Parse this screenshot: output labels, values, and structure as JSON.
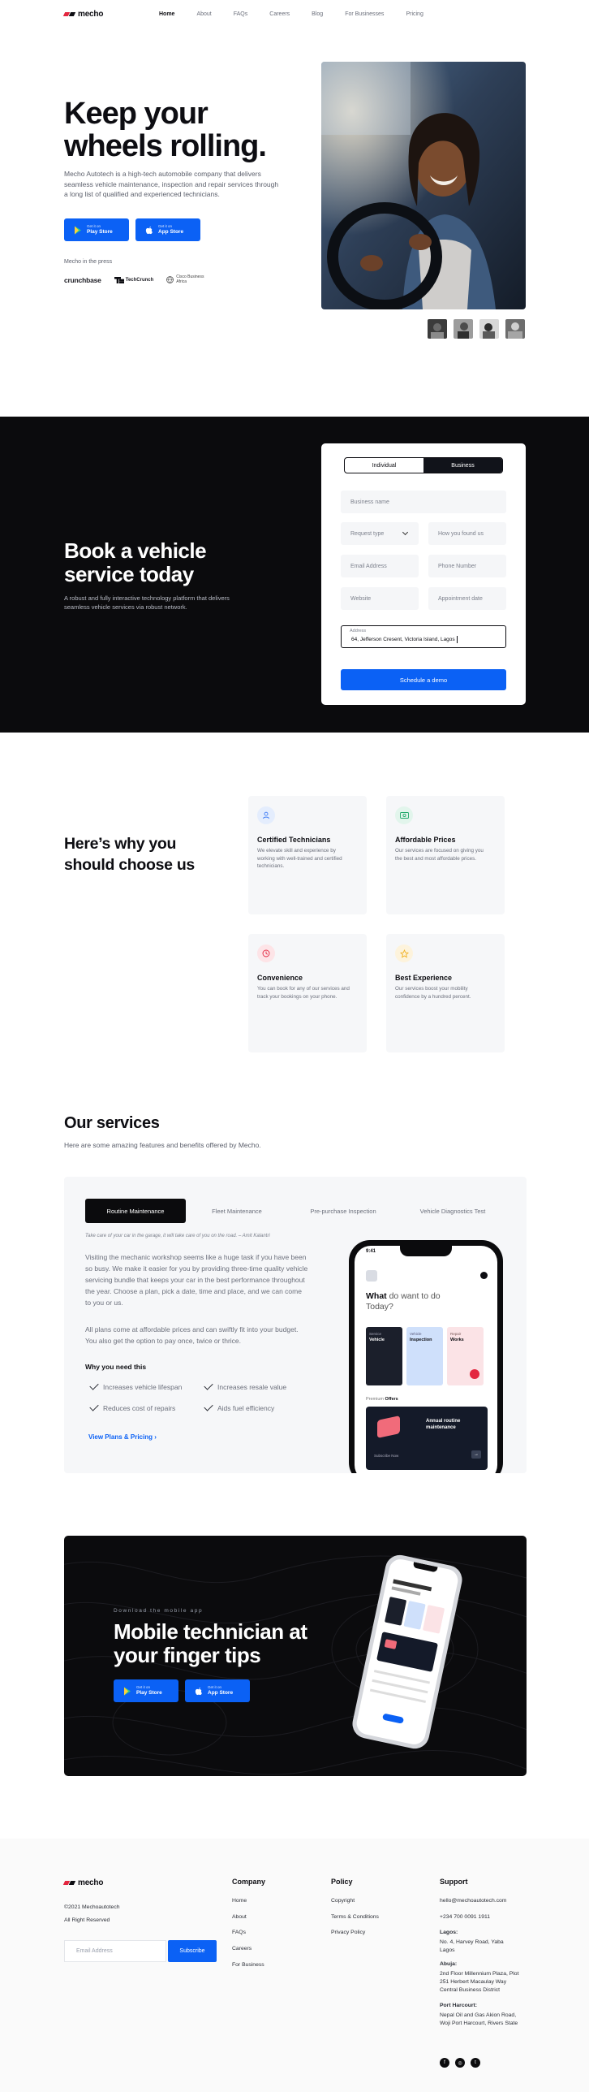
{
  "brand": {
    "name": "mecho",
    "colors": {
      "primary": "#0b61f5",
      "dark": "#0b0b0d",
      "logo_red": "#e3263f"
    }
  },
  "nav": {
    "items": [
      "Home",
      "About",
      "FAQs",
      "Careers",
      "Blog",
      "For Businesses",
      "Pricing"
    ],
    "active": "Home"
  },
  "hero": {
    "title": "Keep your wheels rolling.",
    "subtitle": "Mecho Autotech is a high-tech automobile company that delivers seamless vehicle maintenance, inspection and repair services through a long list of qualified and experienced technicians.",
    "play_store": {
      "small": "Get it on",
      "label": "Play Store"
    },
    "app_store": {
      "small": "Get it on",
      "label": "App Store"
    },
    "press_label": "Mecho in the press",
    "press_logos": [
      "crunchbase",
      "TechCrunch",
      "Cisco Business Africa"
    ]
  },
  "book": {
    "title": "Book a vehicle service today",
    "subtitle": "A robust and fully interactive technology platform that delivers seamless vehicle services via robust network.",
    "tabs": [
      "Individual",
      "Business"
    ],
    "active_tab": "Business",
    "fields": {
      "business_name": "Business name",
      "request_type": "Request type",
      "how_found": "How you found us",
      "email": "Email Address",
      "phone": "Phone Number",
      "website": "Website",
      "appointment": "Appointment date",
      "address_label": "Address",
      "address_value": "64, Jefferson Cresent, Victoria Island, Lagos"
    },
    "submit": "Schedule a demo"
  },
  "why": {
    "title": "Here’s why you should choose us",
    "features": [
      {
        "title": "Certified Technicians",
        "desc": "We elevate skill and experience by working with well-trained and certified technicians.",
        "icon": "user-icon",
        "color": "#3d7bf5"
      },
      {
        "title": "Affordable Prices",
        "desc": "Our services are focused on giving you the best and most affordable prices.",
        "icon": "money-icon",
        "color": "#22a86b"
      },
      {
        "title": "Convenience",
        "desc": "You can book for any of our services and track your bookings on your phone.",
        "icon": "clock-icon",
        "color": "#e3263f"
      },
      {
        "title": "Best Experience",
        "desc": "Our services boost your mobility confidence by a hundred percent.",
        "icon": "star-icon",
        "color": "#f0b020"
      }
    ]
  },
  "services": {
    "title": "Our services",
    "subtitle": "Here are some amazing features and benefits offered by Mecho.",
    "tabs": [
      "Routine Maintenance",
      "Fleet Maintenance",
      "Pre-purchase Inspection",
      "Vehicle Diagnostics Test"
    ],
    "active_tab": "Routine Maintenance",
    "quote": "Take care of your car in the garage, it will take care of you on the road. – Amit Kalantri",
    "p1": "Visiting the mechanic workshop seems like a huge task if you have been so busy. We make it easier for you by providing three-time quality vehicle servicing bundle that keeps your car in the best performance throughout the year. Choose a plan, pick a date, time and place, and we can come to you or us.",
    "p2": "All plans come at affordable prices and can swiftly fit into your budget. You also get the option to pay once, twice or thrice.",
    "need_title": "Why you need this",
    "benefits": [
      "Increases vehicle lifespan",
      "Increases resale value",
      "Reduces cost of repairs",
      "Aids fuel efficiency"
    ],
    "cta": "View Plans & Pricing",
    "phone": {
      "time": "9:41",
      "heading_bold": "What",
      "heading_rest": "do want to do Today?",
      "cards": [
        {
          "small": "Service",
          "label": "Vehicle"
        },
        {
          "small": "Vehicle",
          "label": "Inspection"
        },
        {
          "small": "Repair",
          "label": "Works"
        }
      ],
      "offers_label": "Premium",
      "offers_bold": "Offers",
      "offer_title": "Annual routine maintenance",
      "offer_cta": "Subscribe Now"
    }
  },
  "app_promo": {
    "kicker": "Download the mobile app",
    "title": "Mobile technician at your finger tips",
    "play_store": {
      "small": "Get it on",
      "label": "Play Store"
    },
    "app_store": {
      "small": "Get it on",
      "label": "App Store"
    }
  },
  "footer": {
    "copyright": "©2021 Mechoautotech",
    "rights": "All Right Reserved",
    "email_placeholder": "Email Address",
    "subscribe": "Subscribe",
    "company": {
      "title": "Company",
      "links": [
        "Home",
        "About",
        "FAQs",
        "Careers",
        "For Business"
      ]
    },
    "policy": {
      "title": "Policy",
      "links": [
        "Copyright",
        "Terms & Conditions",
        "Privacy Policy"
      ]
    },
    "support": {
      "title": "Support",
      "email": "hello@mechoautotech.com",
      "phone": "+234 700 0091 1911",
      "lagos_label": "Lagos:",
      "lagos": "No. 4, Harvey Road, Yaba Lagos",
      "abuja_label": "Abuja:",
      "abuja": "2nd Floor Millennium Plaza, Plot 251 Herbert Macaulay Way Central Business District",
      "ph_label": "Port Harcourt:",
      "ph": "Nepal Oil and Gas Akion Road, Woji Port Harcourt, Rivers State"
    }
  }
}
